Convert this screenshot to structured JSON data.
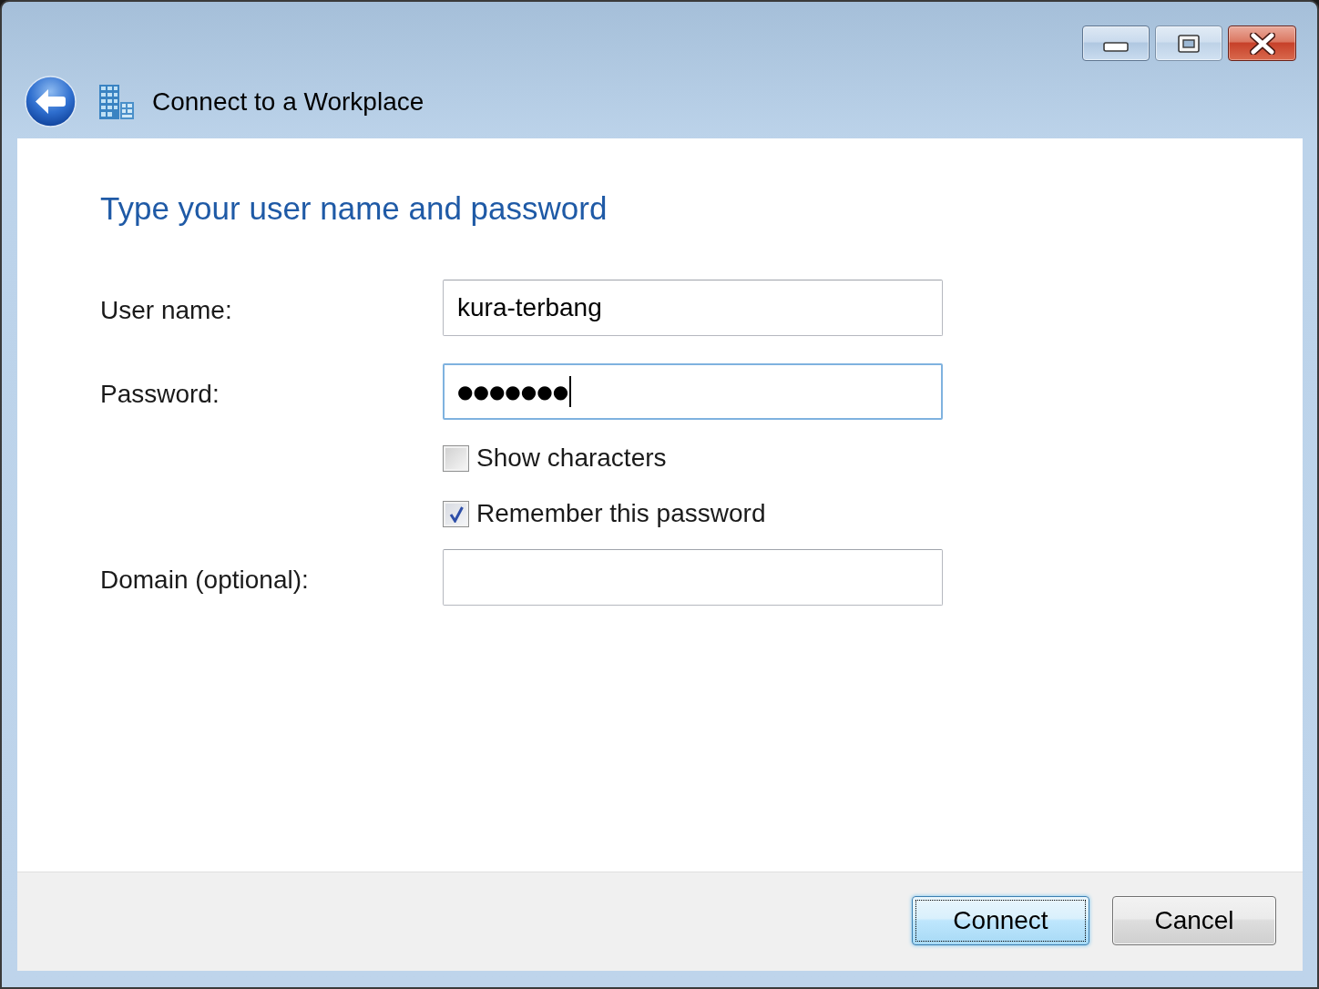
{
  "window": {
    "title": "Connect to a Workplace"
  },
  "heading": "Type your user name and password",
  "fields": [
    {
      "kind": "text",
      "label": "User name:",
      "value": "kura-terbang",
      "focused": false
    },
    {
      "kind": "password",
      "label": "Password:",
      "value": "●●●●●●●",
      "focused": true
    },
    {
      "kind": "checkbox",
      "label": "Show characters",
      "checked": false
    },
    {
      "kind": "checkbox",
      "label": "Remember this password",
      "checked": true
    },
    {
      "kind": "text",
      "label": "Domain (optional):",
      "focused": false
    }
  ],
  "buttons": [
    {
      "label": "Connect",
      "default": true
    },
    {
      "label": "Cancel",
      "default": false
    }
  ]
}
